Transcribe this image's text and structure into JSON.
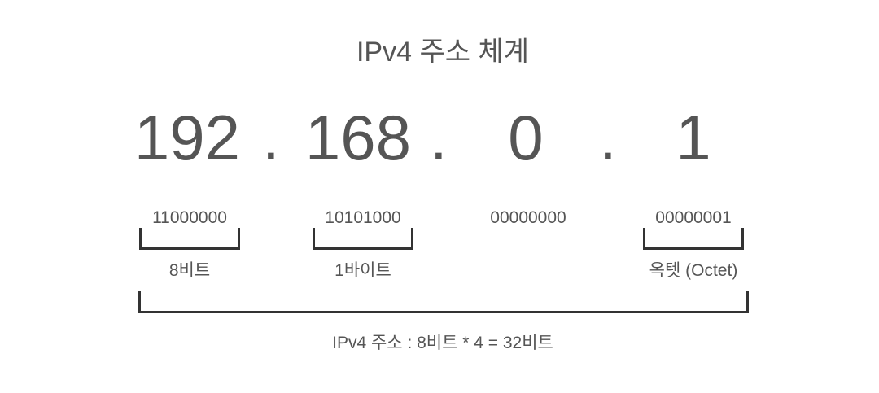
{
  "title": "IPv4 주소 체계",
  "octets": [
    {
      "decimal": "192",
      "binary": "11000000"
    },
    {
      "decimal": "168",
      "binary": "10101000"
    },
    {
      "decimal": "0",
      "binary": "00000000"
    },
    {
      "decimal": "1",
      "binary": "00000001"
    }
  ],
  "separator": ".",
  "labels": {
    "bits": "8비트",
    "byte": "1바이트",
    "octet": "옥텟 (Octet)"
  },
  "summary": "IPv4 주소 : 8비트 * 4 = 32비트"
}
